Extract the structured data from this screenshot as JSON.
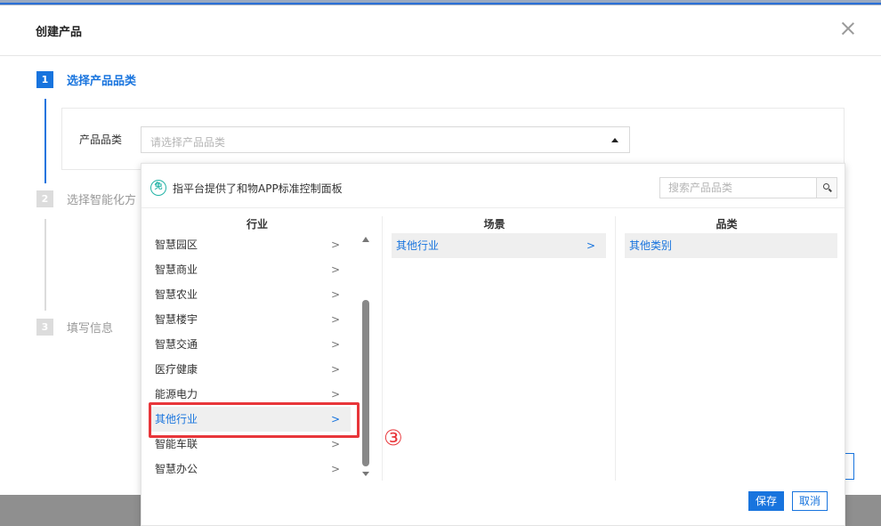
{
  "modal": {
    "title": "创建产品"
  },
  "steps": [
    {
      "number": "1",
      "label": "选择产品品类",
      "state": "active"
    },
    {
      "number": "2",
      "label": "选择智能化方",
      "state": "inactive"
    },
    {
      "number": "3",
      "label": "填写信息",
      "state": "inactive"
    }
  ],
  "form": {
    "category_label": "产品品类",
    "category_placeholder": "请选择产品品类"
  },
  "dropdown": {
    "badge_icon_text": "免",
    "tip": "指平台提供了和物APP标准控制面板",
    "search_placeholder": "搜索产品品类",
    "columns": {
      "industry": {
        "header": "行业",
        "items": [
          "智慧园区",
          "智慧商业",
          "智慧农业",
          "智慧楼宇",
          "智慧交通",
          "医疗健康",
          "能源电力",
          "其他行业",
          "智能车联",
          "智慧办公"
        ],
        "selected": "其他行业"
      },
      "scene": {
        "header": "场景",
        "items": [
          "其他行业"
        ],
        "selected": "其他行业"
      },
      "category": {
        "header": "品类",
        "items": [
          "其他类别"
        ],
        "selected": "其他类别"
      }
    },
    "save_label": "保存",
    "cancel_label": "取消"
  },
  "annotation": {
    "marker": "③",
    "color": "#e8363a"
  },
  "colors": {
    "accent": "#1874de",
    "badge": "#22b3a6"
  }
}
